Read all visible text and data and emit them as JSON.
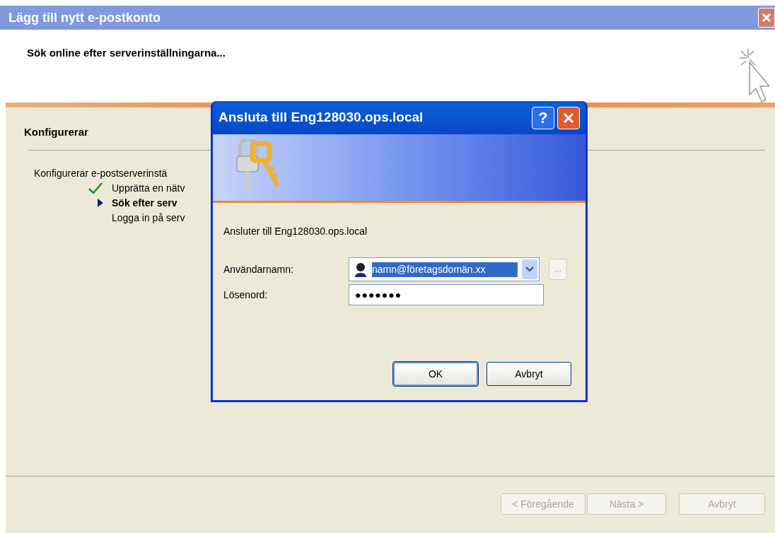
{
  "window": {
    "title": "Lägg till nytt e-postkonto",
    "active": false
  },
  "header": {
    "title": "Sök online efter serverinställningarna..."
  },
  "section": {
    "title": "Konfigurerar",
    "intro": "Konfigurerar e-postserverinstä",
    "steps": [
      {
        "kind": "done",
        "label": "Upprätta en nätv"
      },
      {
        "kind": "current",
        "label": "Sök efter serv"
      },
      {
        "kind": "pending",
        "label": "Logga in på serv"
      }
    ]
  },
  "buttons": [
    {
      "label": "< Föregående",
      "disabled": true
    },
    {
      "label": "Nästa >",
      "disabled": true
    },
    {
      "label": "Avbryt",
      "disabled": true
    }
  ],
  "dialog": {
    "title": "Ansluta till Eng128030.ops.local",
    "help": "?",
    "message": "Ansluter till Eng128030.ops.local",
    "username": {
      "label": "Användarnamn:",
      "value": "namn@företagsdomän.xx",
      "text_selected": true
    },
    "browse": {
      "label": "...",
      "disabled": true
    },
    "password": {
      "label": "Lösenord:",
      "value": "●●●●●●●"
    },
    "buttons": [
      {
        "label": "OK",
        "default": true
      },
      {
        "label": "Avbryt",
        "default": false
      }
    ]
  }
}
